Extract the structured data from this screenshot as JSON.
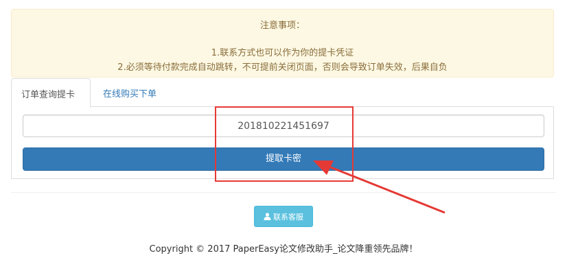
{
  "notice": {
    "title": "注意事项：",
    "line1": "1.联系方式也可以作为你的提卡凭证",
    "line2": "2.必须等待付款完成自动跳转，不可提前关闭页面，否则会导致订单失效，后果自负"
  },
  "tabs": [
    {
      "label": "订单查询提卡",
      "active": true
    },
    {
      "label": "在线购买下单",
      "active": false
    }
  ],
  "order_form": {
    "order_number": "201810221451697",
    "submit_label": "提取卡密"
  },
  "footer": {
    "support_label": "联系客服",
    "support_icon": "user-icon",
    "copyright": "Copyright © 2017 PaperEasy论文修改助手_论文降重领先品牌！"
  },
  "colors": {
    "notice_bg": "#fcf8e3",
    "primary": "#337ab7",
    "info": "#5bc0de",
    "annotation": "#e53935"
  }
}
